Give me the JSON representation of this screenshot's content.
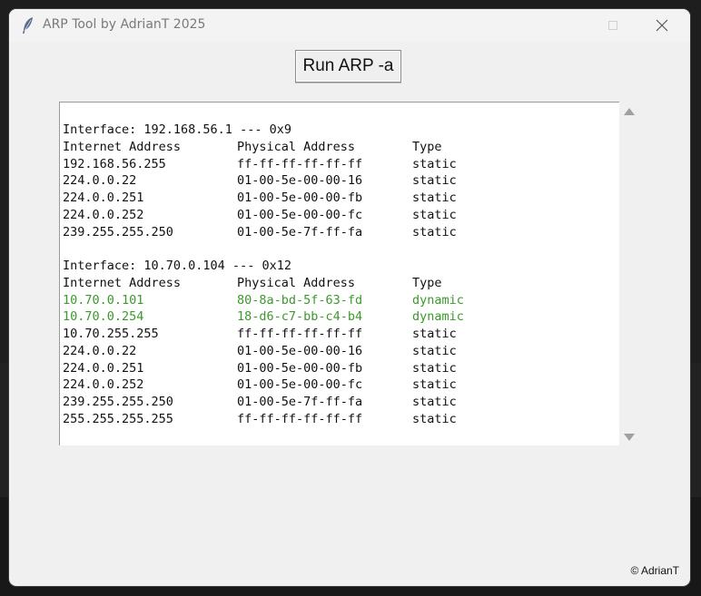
{
  "window": {
    "title": "ARP Tool by AdrianT 2025",
    "controls": [
      "minimize",
      "maximize",
      "close"
    ]
  },
  "toolbar": {
    "run_label": "Run ARP -a"
  },
  "output": {
    "interfaces": [
      {
        "header": "Interface: 192.168.56.1 --- 0x9",
        "columns": [
          "Internet Address",
          "Physical Address",
          "Type"
        ],
        "rows": [
          [
            "192.168.56.255",
            "ff-ff-ff-ff-ff-ff",
            "static"
          ],
          [
            "224.0.0.22",
            "01-00-5e-00-00-16",
            "static"
          ],
          [
            "224.0.0.251",
            "01-00-5e-00-00-fb",
            "static"
          ],
          [
            "224.0.0.252",
            "01-00-5e-00-00-fc",
            "static"
          ],
          [
            "239.255.255.250",
            "01-00-5e-7f-ff-fa",
            "static"
          ]
        ]
      },
      {
        "header": "Interface: 10.70.0.104 --- 0x12",
        "columns": [
          "Internet Address",
          "Physical Address",
          "Type"
        ],
        "rows": [
          [
            "10.70.0.101",
            "80-8a-bd-5f-63-fd",
            "dynamic"
          ],
          [
            "10.70.0.254",
            "18-d6-c7-bb-c4-b4",
            "dynamic"
          ],
          [
            "10.70.255.255",
            "ff-ff-ff-ff-ff-ff",
            "static"
          ],
          [
            "224.0.0.22",
            "01-00-5e-00-00-16",
            "static"
          ],
          [
            "224.0.0.251",
            "01-00-5e-00-00-fb",
            "static"
          ],
          [
            "224.0.0.252",
            "01-00-5e-00-00-fc",
            "static"
          ],
          [
            "239.255.255.250",
            "01-00-5e-7f-ff-fa",
            "static"
          ],
          [
            "255.255.255.255",
            "ff-ff-ff-ff-ff-ff",
            "static"
          ]
        ]
      }
    ]
  },
  "footer": {
    "credit": "© AdrianT"
  },
  "colors": {
    "dynamic": "#3a9a2a",
    "static": "#111111",
    "window_bg": "#f0f0f0"
  },
  "icons": {
    "app": "feather-icon"
  }
}
